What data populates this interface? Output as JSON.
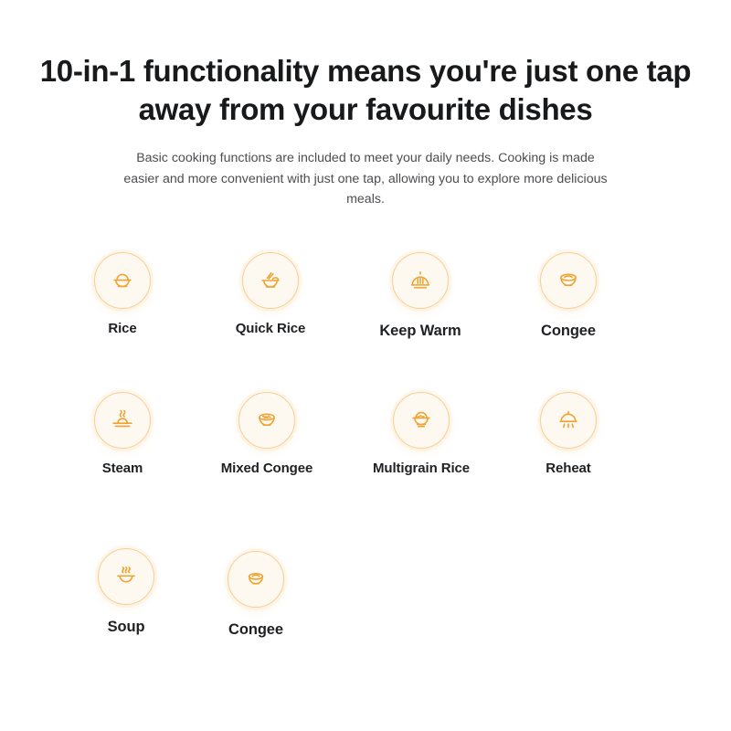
{
  "header": {
    "headline": "10-in-1 functionality means you're just one tap away from your favourite dishes",
    "subcopy": "Basic cooking functions are included to meet your daily needs. Cooking is made easier and more convenient with just one tap, allowing you to explore more delicious meals."
  },
  "theme": {
    "icon_stroke": "#f0a330",
    "badge_fill": "#fdf8f0",
    "badge_ring": "#f7cf95",
    "label_color": "#1f2023",
    "body_text_color": "#4c4d50",
    "headline_color": "#18191b",
    "background": "#ffffff"
  },
  "functions": [
    {
      "label": "Rice",
      "icon": "rice-bowl-icon"
    },
    {
      "label": "Quick Rice",
      "icon": "noodle-bowl-chopsticks-icon"
    },
    {
      "label": "Keep Warm",
      "icon": "cloche-heat-icon"
    },
    {
      "label": "Congee",
      "icon": "congee-bowl-icon"
    },
    {
      "label": "Steam",
      "icon": "steam-plate-icon"
    },
    {
      "label": "Mixed Congee",
      "icon": "mixed-grain-bowl-icon"
    },
    {
      "label": "Multigrain Rice",
      "icon": "multigrain-bowl-icon"
    },
    {
      "label": "Reheat",
      "icon": "reheat-dome-icon"
    },
    {
      "label": "Soup",
      "icon": "soup-bowl-steam-icon"
    },
    {
      "label": "Congee",
      "icon": "congee-bowl-icon"
    }
  ]
}
